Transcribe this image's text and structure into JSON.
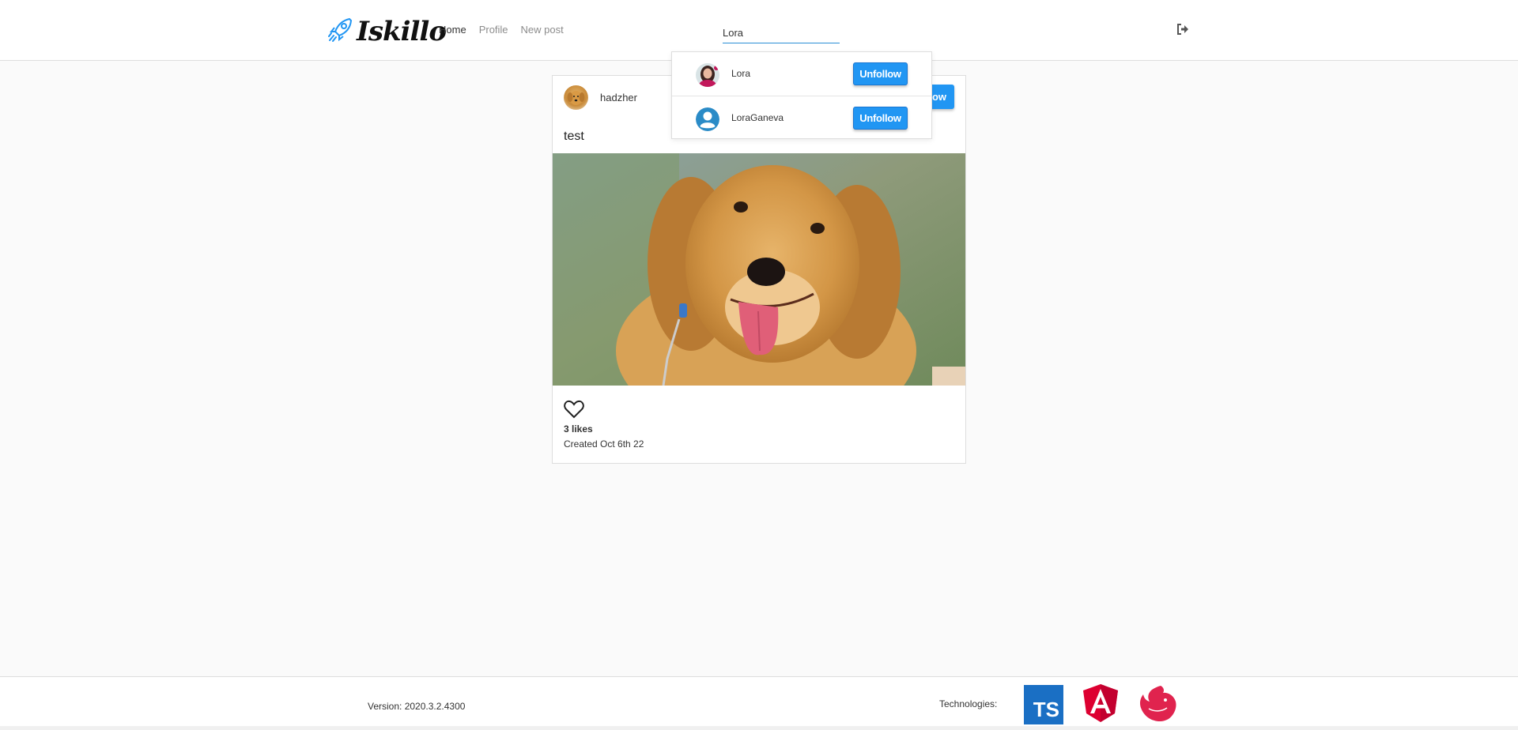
{
  "app": {
    "brand": "Iskillo",
    "accent_color": "#2196f3"
  },
  "nav": {
    "items": [
      {
        "label": "Home",
        "active": true
      },
      {
        "label": "Profile",
        "active": false
      },
      {
        "label": "New post",
        "active": false
      }
    ],
    "search_value": "Lora",
    "logout_icon": "sign-out-icon"
  },
  "post": {
    "username": "hadzher",
    "follow_label": "low",
    "caption": "test",
    "likes": "3 likes",
    "created": "Created Oct 6th 22",
    "like_icon": "heart-outline-icon"
  },
  "search_results": [
    {
      "name": "Lora",
      "button": "Unfollow",
      "avatar": "photo"
    },
    {
      "name": "LoraGaneva",
      "button": "Unfollow",
      "avatar": "default-user-icon"
    }
  ],
  "footer": {
    "version": "Version: 2020.3.2.4300",
    "technologies_label": "Technologies:",
    "technologies": [
      {
        "name": "TypeScript",
        "badge": "TS"
      },
      {
        "name": "Angular",
        "badge": "A"
      },
      {
        "name": "NestJS",
        "badge": ""
      }
    ]
  }
}
